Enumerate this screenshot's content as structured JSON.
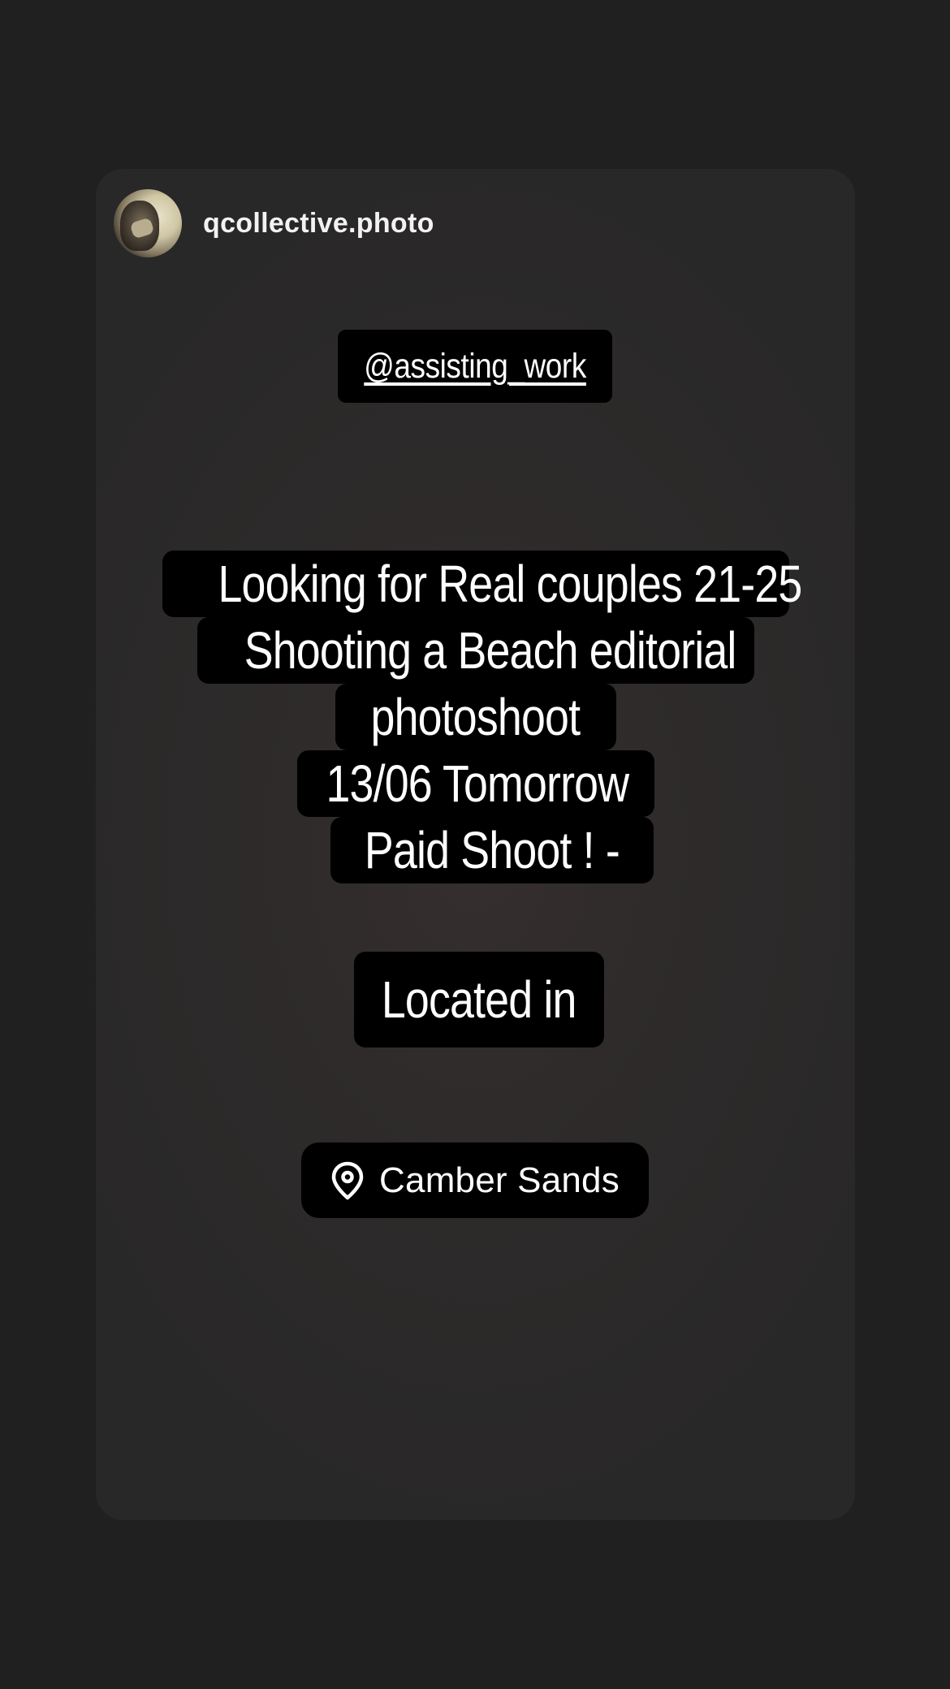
{
  "story": {
    "username": "qcollective.photo",
    "mention": "@assisting_work",
    "main_text_lines": [
      "Looking for Real couples 21-25",
      "Shooting a Beach editorial",
      "photoshoot",
      "13/06 Tomorrow",
      "Paid Shoot ! -"
    ],
    "located_label": "Located in",
    "location": {
      "icon": "location-pin-icon",
      "name": "Camber Sands"
    }
  },
  "colors": {
    "background": "#202020",
    "card": "#2d2a2a",
    "sticker": "#000000",
    "text": "#ffffff"
  }
}
